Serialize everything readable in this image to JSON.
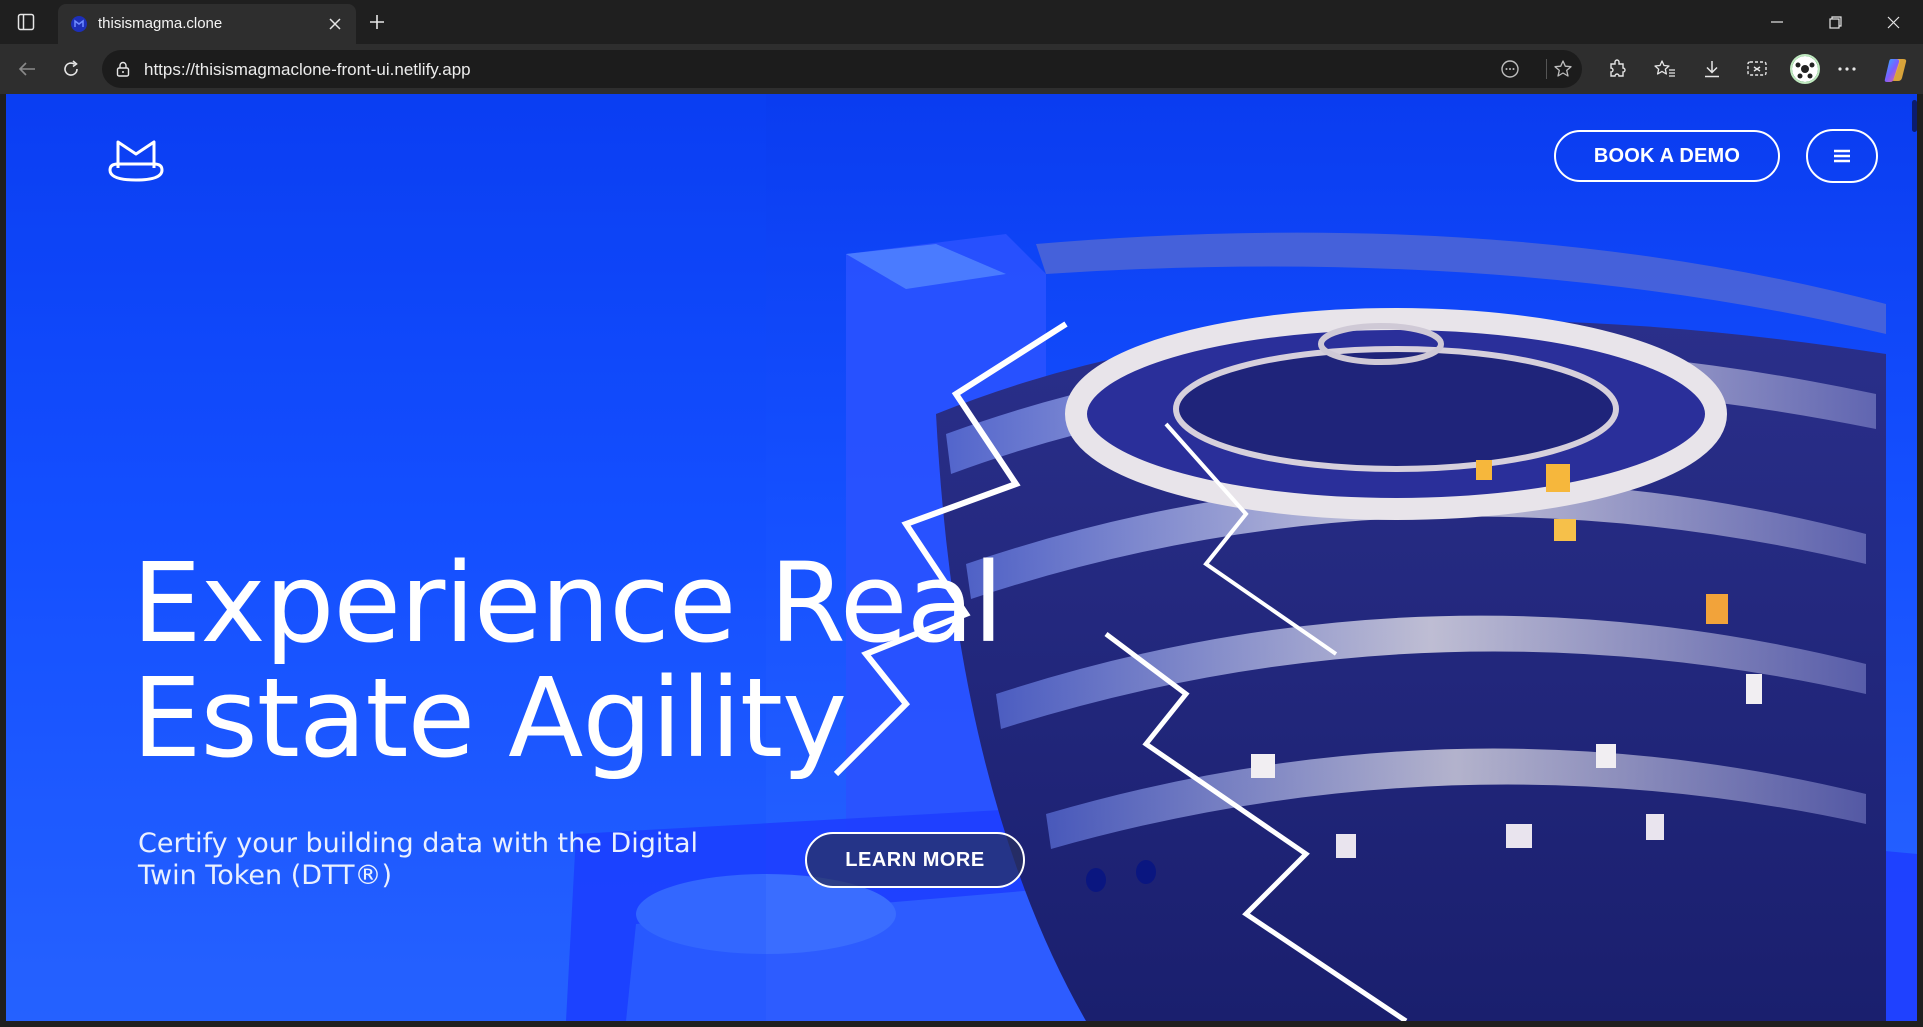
{
  "browser": {
    "tab": {
      "title": "thisismagma.clone"
    },
    "address": {
      "url": "https://thisismagmaclone-front-ui.netlify.app"
    }
  },
  "page": {
    "header": {
      "cta_label": "BOOK A DEMO"
    },
    "hero": {
      "title_line1": "Experience Real",
      "title_line2": "Estate Agility",
      "subtitle": "Certify your building data with the Digital Twin Token (DTT®)",
      "button_label": "LEARN MORE"
    }
  },
  "colors": {
    "hero_blue": "#1550ff",
    "tab_background": "#2e2e2e",
    "titlebar_background": "#1f1f1f"
  }
}
